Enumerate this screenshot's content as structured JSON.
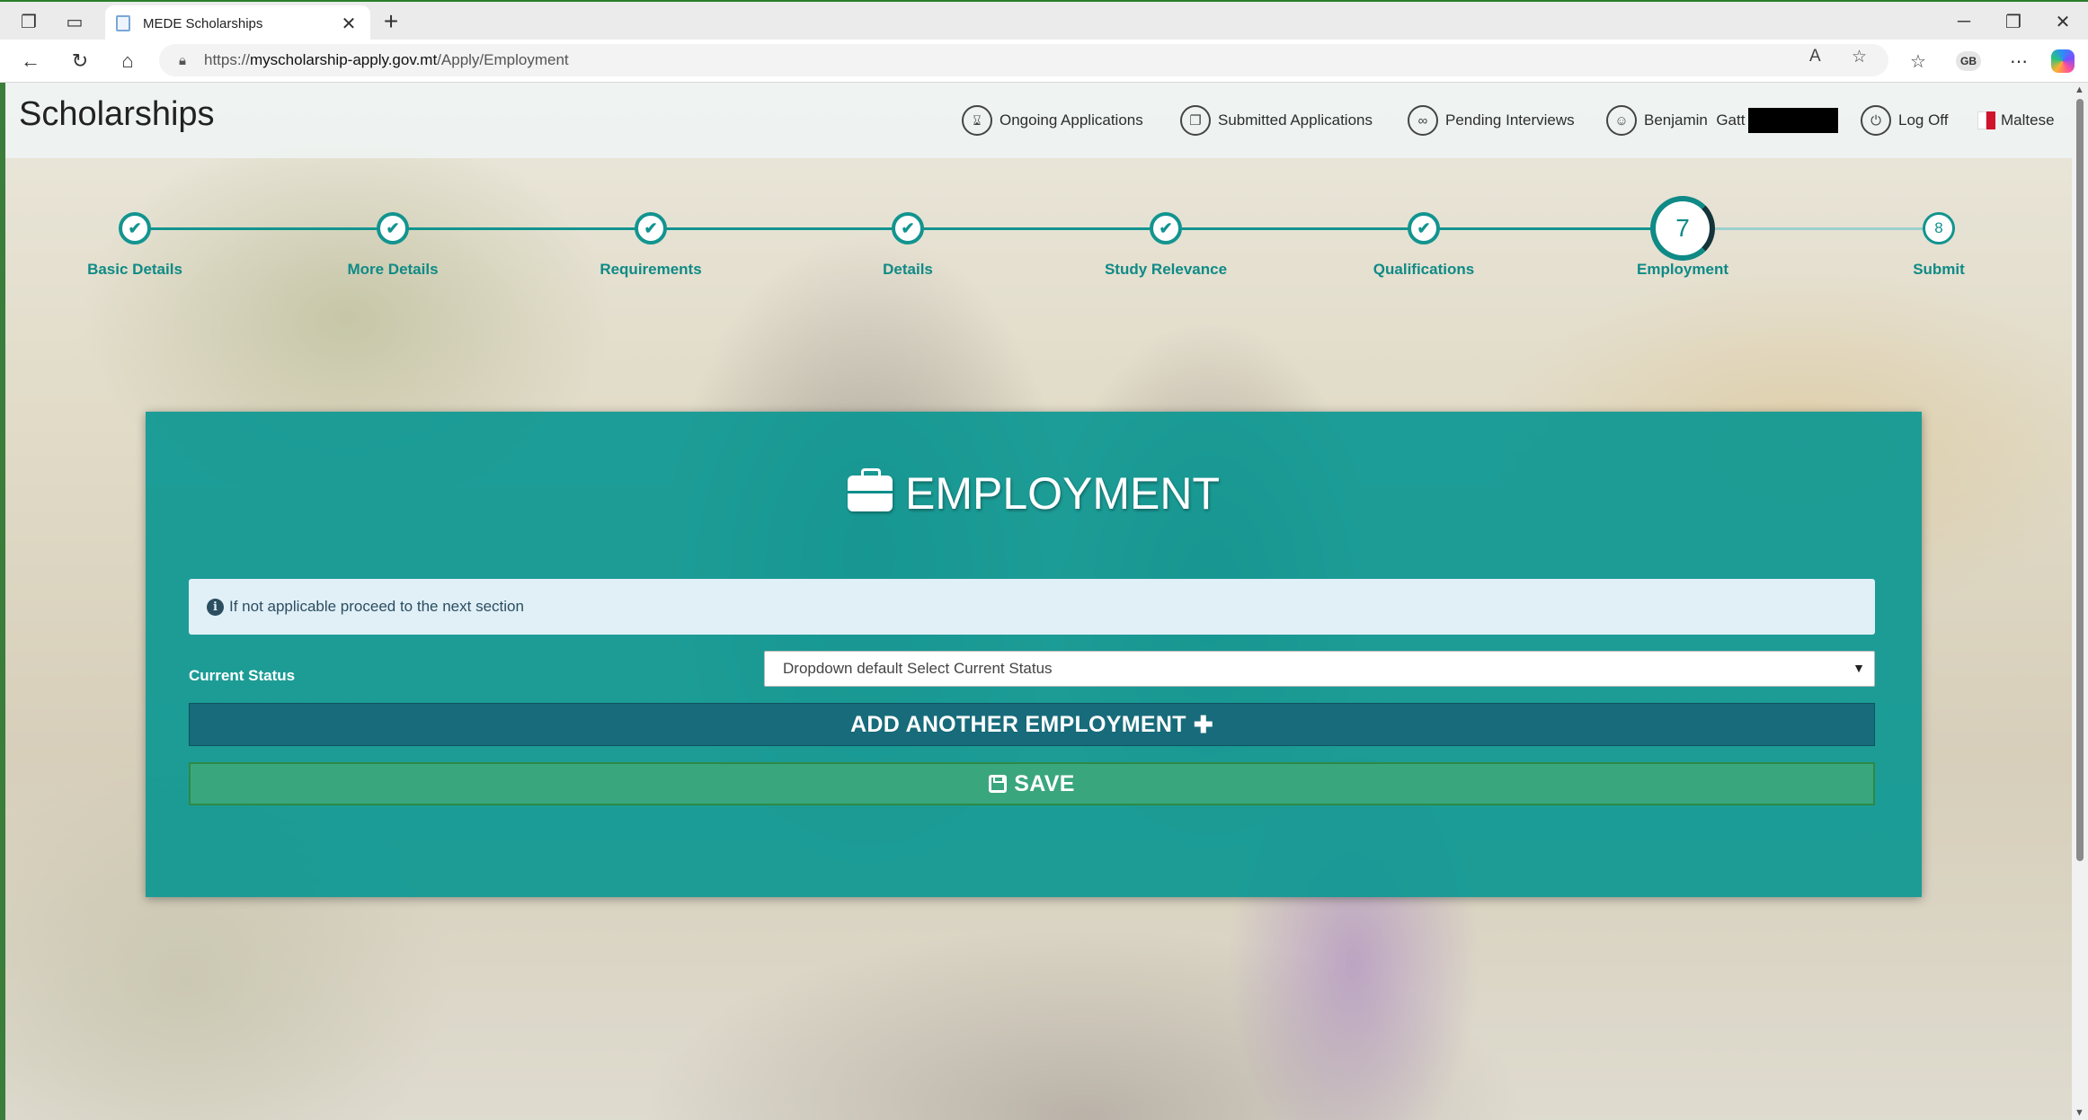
{
  "browser": {
    "tab_title": "MEDE Scholarships",
    "url_prefix": "https://",
    "url_domain": "myscholarship-apply.gov.mt",
    "url_path": "/Apply/Employment",
    "profile_initials": "GB"
  },
  "header": {
    "brand": "Scholarships",
    "nav": [
      {
        "label": "Ongoing Applications",
        "icon": "hourglass-icon"
      },
      {
        "label": "Submitted Applications",
        "icon": "documents-icon"
      },
      {
        "label": "Pending Interviews",
        "icon": "handshake-icon"
      },
      {
        "label": "Benjamin  Gatt",
        "icon": "user-icon"
      },
      {
        "label": "Log Off",
        "icon": "power-icon"
      },
      {
        "label": "Maltese",
        "icon": "malta-flag-icon"
      }
    ]
  },
  "stepper": {
    "steps": [
      {
        "label": "Basic Details",
        "state": "done",
        "mark": "✔"
      },
      {
        "label": "More Details",
        "state": "done",
        "mark": "✔"
      },
      {
        "label": "Requirements",
        "state": "done",
        "mark": "✔"
      },
      {
        "label": "Details",
        "state": "done",
        "mark": "✔"
      },
      {
        "label": "Study Relevance",
        "state": "done",
        "mark": "✔"
      },
      {
        "label": "Qualifications",
        "state": "done",
        "mark": "✔"
      },
      {
        "label": "Employment",
        "state": "current",
        "mark": "7"
      },
      {
        "label": "Submit",
        "state": "todo",
        "mark": "8"
      }
    ]
  },
  "main": {
    "title": "EMPLOYMENT",
    "info": "If not applicable proceed to the next section",
    "current_status_label": "Current Status",
    "current_status_value": "Dropdown default Select Current Status",
    "add_button": "ADD ANOTHER EMPLOYMENT",
    "save_button": "SAVE"
  },
  "colors": {
    "teal": "#0a9690",
    "step_teal": "#12948f",
    "add_button": "#176b7a",
    "save_button": "#3aa67d"
  }
}
